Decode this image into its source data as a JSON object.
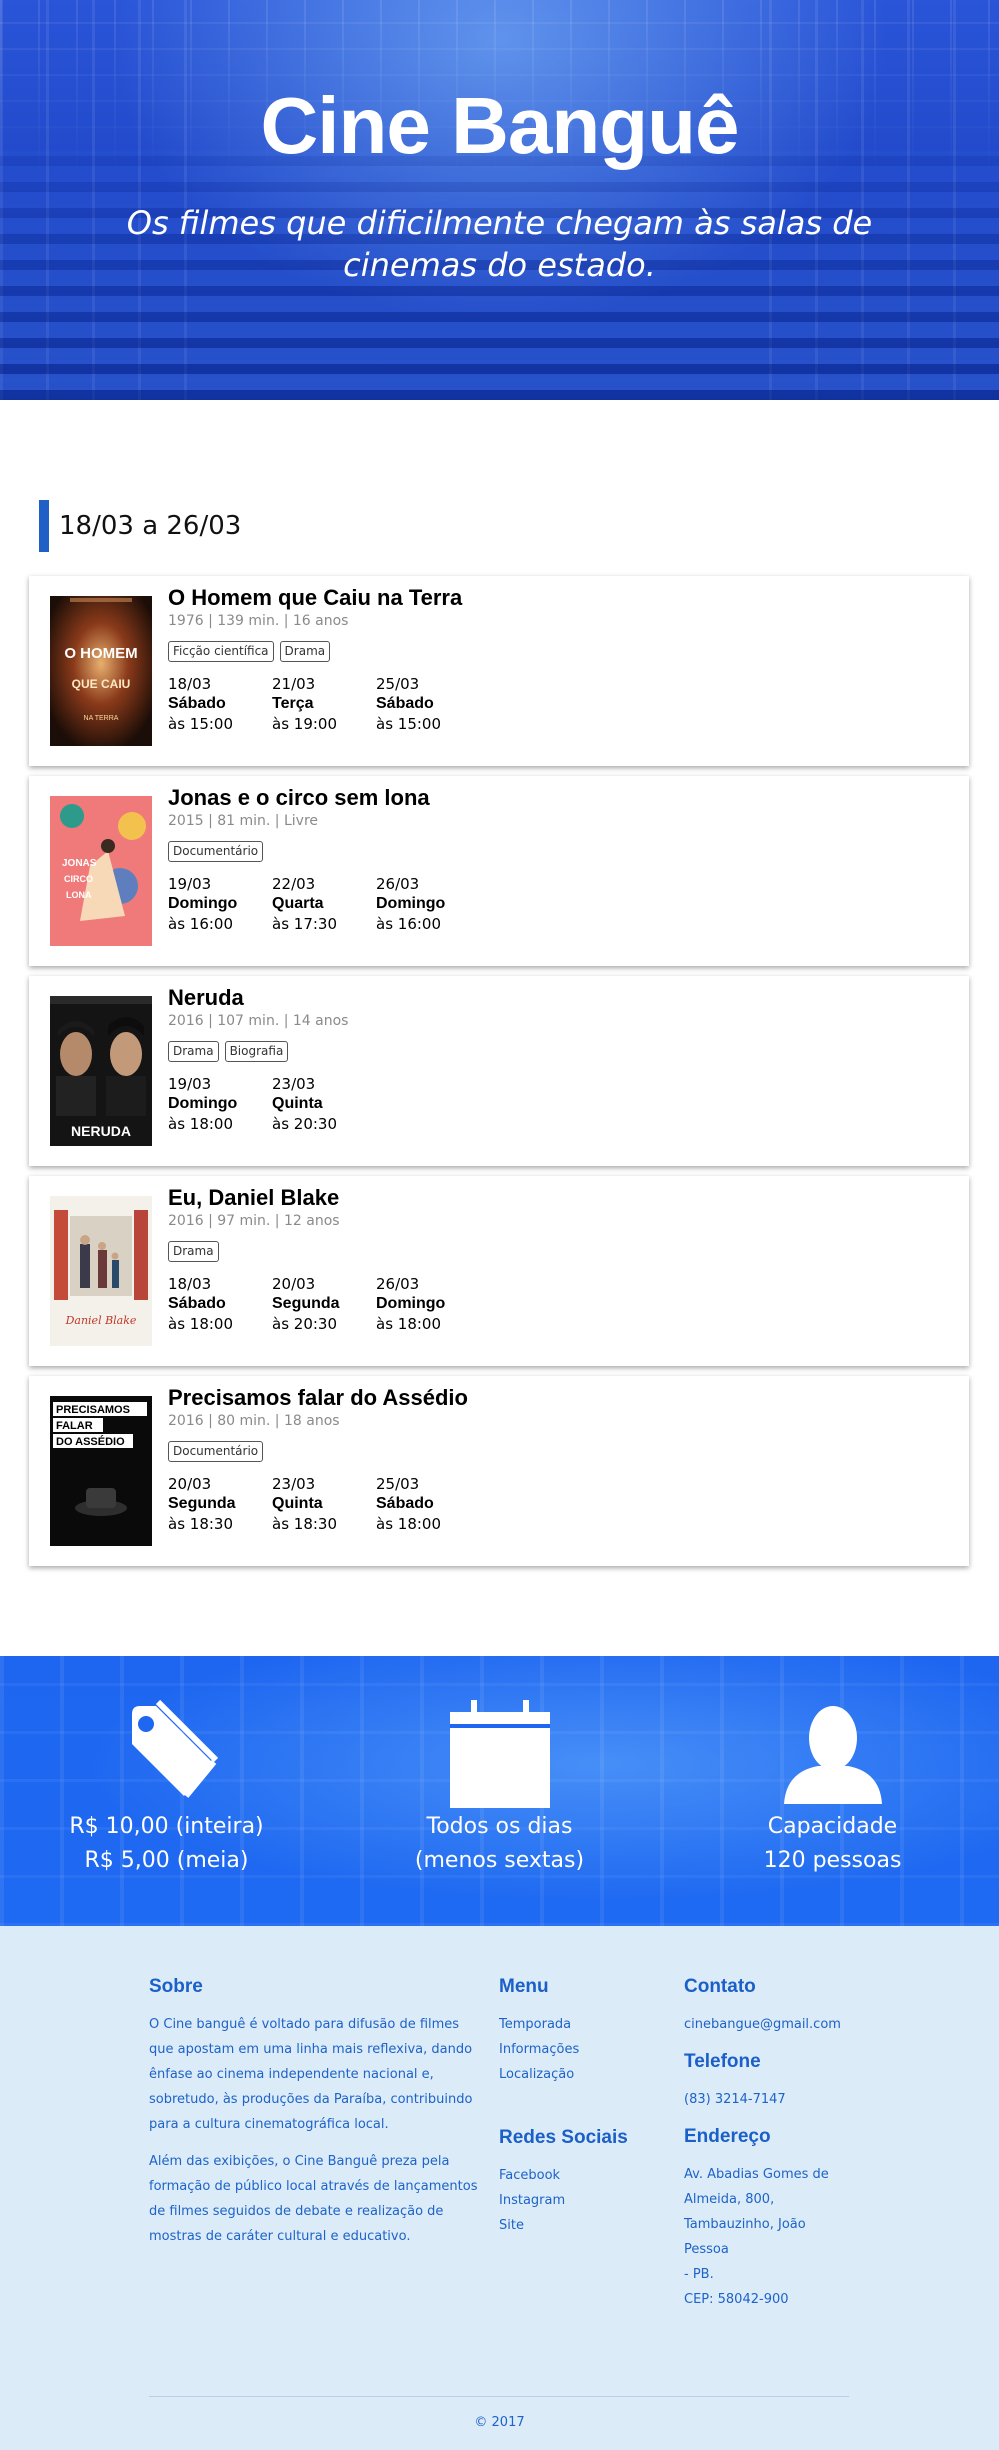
{
  "hero": {
    "title": "Cine Banguê",
    "subtitle": "Os filmes que dificilmente chegam às salas de cinemas do estado."
  },
  "schedule": {
    "period": "18/03 a 26/03",
    "films": [
      {
        "title": "O Homem que Caiu na Terra",
        "meta": "1976 | 139 min. | 16 anos",
        "genres": [
          "Ficção científica",
          "Drama"
        ],
        "poster_lines": [
          "O HOMEM",
          "QUE CAIU",
          "NA TERRA"
        ],
        "sessions": [
          {
            "date": "18/03",
            "weekday": "Sábado",
            "time": "às 15:00"
          },
          {
            "date": "21/03",
            "weekday": "Terça",
            "time": "às 19:00"
          },
          {
            "date": "25/03",
            "weekday": "Sábado",
            "time": "às 15:00"
          }
        ]
      },
      {
        "title": "Jonas e o circo sem lona",
        "meta": "2015 | 81 min. | Livre",
        "genres": [
          "Documentário"
        ],
        "poster_lines": [
          "JONAS",
          "CIRCO",
          "LONA"
        ],
        "sessions": [
          {
            "date": "19/03",
            "weekday": "Domingo",
            "time": "às 16:00"
          },
          {
            "date": "22/03",
            "weekday": "Quarta",
            "time": "às 17:30"
          },
          {
            "date": "26/03",
            "weekday": "Domingo",
            "time": "às 16:00"
          }
        ]
      },
      {
        "title": "Neruda",
        "meta": "2016 | 107 min. | 14 anos",
        "genres": [
          "Drama",
          "Biografia"
        ],
        "poster_lines": [
          "NERUDA"
        ],
        "sessions": [
          {
            "date": "19/03",
            "weekday": "Domingo",
            "time": "às 18:00"
          },
          {
            "date": "23/03",
            "weekday": "Quinta",
            "time": "às 20:30"
          }
        ]
      },
      {
        "title": "Eu, Daniel Blake",
        "meta": "2016 | 97 min. | 12 anos",
        "genres": [
          "Drama"
        ],
        "poster_lines": [
          "Daniel Blake"
        ],
        "sessions": [
          {
            "date": "18/03",
            "weekday": "Sábado",
            "time": "às 18:00"
          },
          {
            "date": "20/03",
            "weekday": "Segunda",
            "time": "às 20:30"
          },
          {
            "date": "26/03",
            "weekday": "Domingo",
            "time": "às 18:00"
          }
        ]
      },
      {
        "title": "Precisamos falar do Assédio",
        "meta": "2016 | 80 min. | 18 anos",
        "genres": [
          "Documentário"
        ],
        "poster_lines": [
          "PRECISAMOS",
          "FALAR",
          "DO ASSÉDIO"
        ],
        "sessions": [
          {
            "date": "20/03",
            "weekday": "Segunda",
            "time": "às 18:30"
          },
          {
            "date": "23/03",
            "weekday": "Quinta",
            "time": "às 18:30"
          },
          {
            "date": "25/03",
            "weekday": "Sábado",
            "time": "às 18:00"
          }
        ]
      }
    ]
  },
  "features": [
    {
      "icon": "price-tag-icon",
      "line1": "R$ 10,00 (inteira)",
      "line2": "R$ 5,00 (meia)"
    },
    {
      "icon": "calendar-icon",
      "line1": "Todos os dias",
      "line2": "(menos sextas)"
    },
    {
      "icon": "person-icon",
      "line1": "Capacidade",
      "line2": "120 pessoas"
    }
  ],
  "footer": {
    "about": {
      "title": "Sobre",
      "p1": "O Cine banguê é voltado para difusão de filmes que apostam em uma linha mais reflexiva, dando ênfase ao cinema independente nacional e, sobretudo, às produções da Paraíba, contribuindo para a cultura cinematográfica local.",
      "p2": "Além das exibições, o Cine Banguê preza pela formação de público local através de lançamentos de filmes seguidos de debate e realização de mostras de caráter cultural e educativo."
    },
    "menu": {
      "title": "Menu",
      "items": [
        "Temporada",
        "Informações",
        "Localização"
      ]
    },
    "social": {
      "title": "Redes Sociais",
      "items": [
        "Facebook",
        "Instagram",
        "Site"
      ]
    },
    "contact": {
      "title": "Contato",
      "email": "cinebangue@gmail.com"
    },
    "phone": {
      "title": "Telefone",
      "value": "(83) 3214-7147"
    },
    "address": {
      "title": "Endereço",
      "line1": "Av. Abadias Gomes de",
      "line2": "Almeida, 800,",
      "line3": "Tambauzinho, João Pessoa",
      "line4": "- PB.",
      "line5": "CEP: 58042-900"
    },
    "copyright": "© 2017"
  },
  "colors": {
    "accent": "#1f5fc6",
    "features_bg": "#1e66f0",
    "footer_bg": "#dcebf8",
    "footer_text": "#1d63c9"
  }
}
